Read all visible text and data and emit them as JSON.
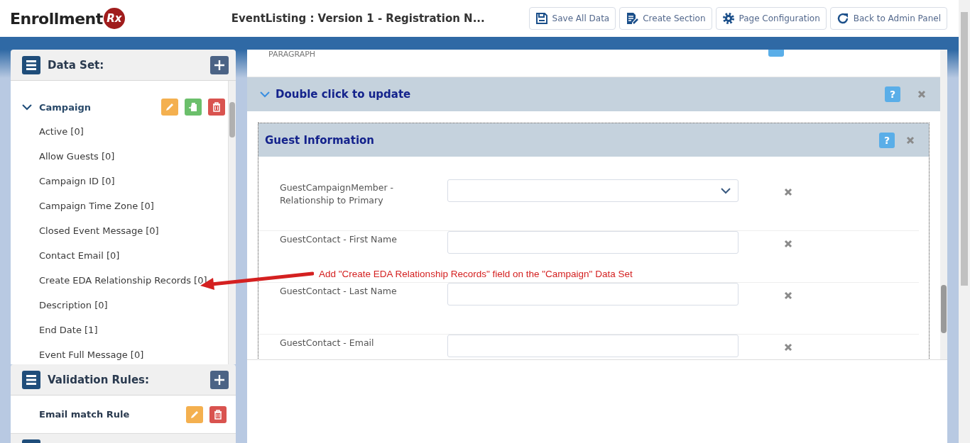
{
  "header": {
    "logo_text": "Enrollment",
    "logo_badge": "Rx",
    "title": "EventListing : Version 1 - Registration N...",
    "buttons": [
      {
        "label": "Save All Data",
        "kind": "save"
      },
      {
        "label": "Create Section",
        "kind": "section"
      },
      {
        "label": "Page Configuration",
        "kind": "config"
      },
      {
        "label": "Back to Admin Panel",
        "kind": "back"
      }
    ]
  },
  "sidebar": {
    "data_set": {
      "title": "Data Set:",
      "groups": [
        {
          "name": "Campaign",
          "expanded": true,
          "fields": [
            "Active [0]",
            "Allow Guests [0]",
            "Campaign ID [0]",
            "Campaign Time Zone [0]",
            "Closed Event Message [0]",
            "Contact Email [0]",
            "Create EDA Relationship Records [0]",
            "Description [0]",
            "End Date [1]",
            "Event Full Message [0]"
          ]
        }
      ]
    },
    "validation_rules": {
      "title": "Validation Rules:",
      "items": [
        "Email match Rule"
      ]
    }
  },
  "main": {
    "top_label": "PARAGRAPH",
    "sections": [
      {
        "title": "Double click to update",
        "help": "?",
        "expanded": true,
        "subsections": [
          {
            "title": "Guest Information",
            "help": "?",
            "fields": [
              {
                "label": "GuestCampaignMember - Relationship to Primary",
                "kind": "select"
              },
              {
                "label": "GuestContact - First Name",
                "kind": "text"
              },
              {
                "label": "GuestContact - Last Name",
                "kind": "text"
              },
              {
                "label": "GuestContact - Email",
                "kind": "text"
              }
            ]
          }
        ]
      }
    ]
  },
  "annotation": {
    "text": "Add \"Create EDA Relationship Records\" field on the \"Campaign\" Data Set"
  }
}
